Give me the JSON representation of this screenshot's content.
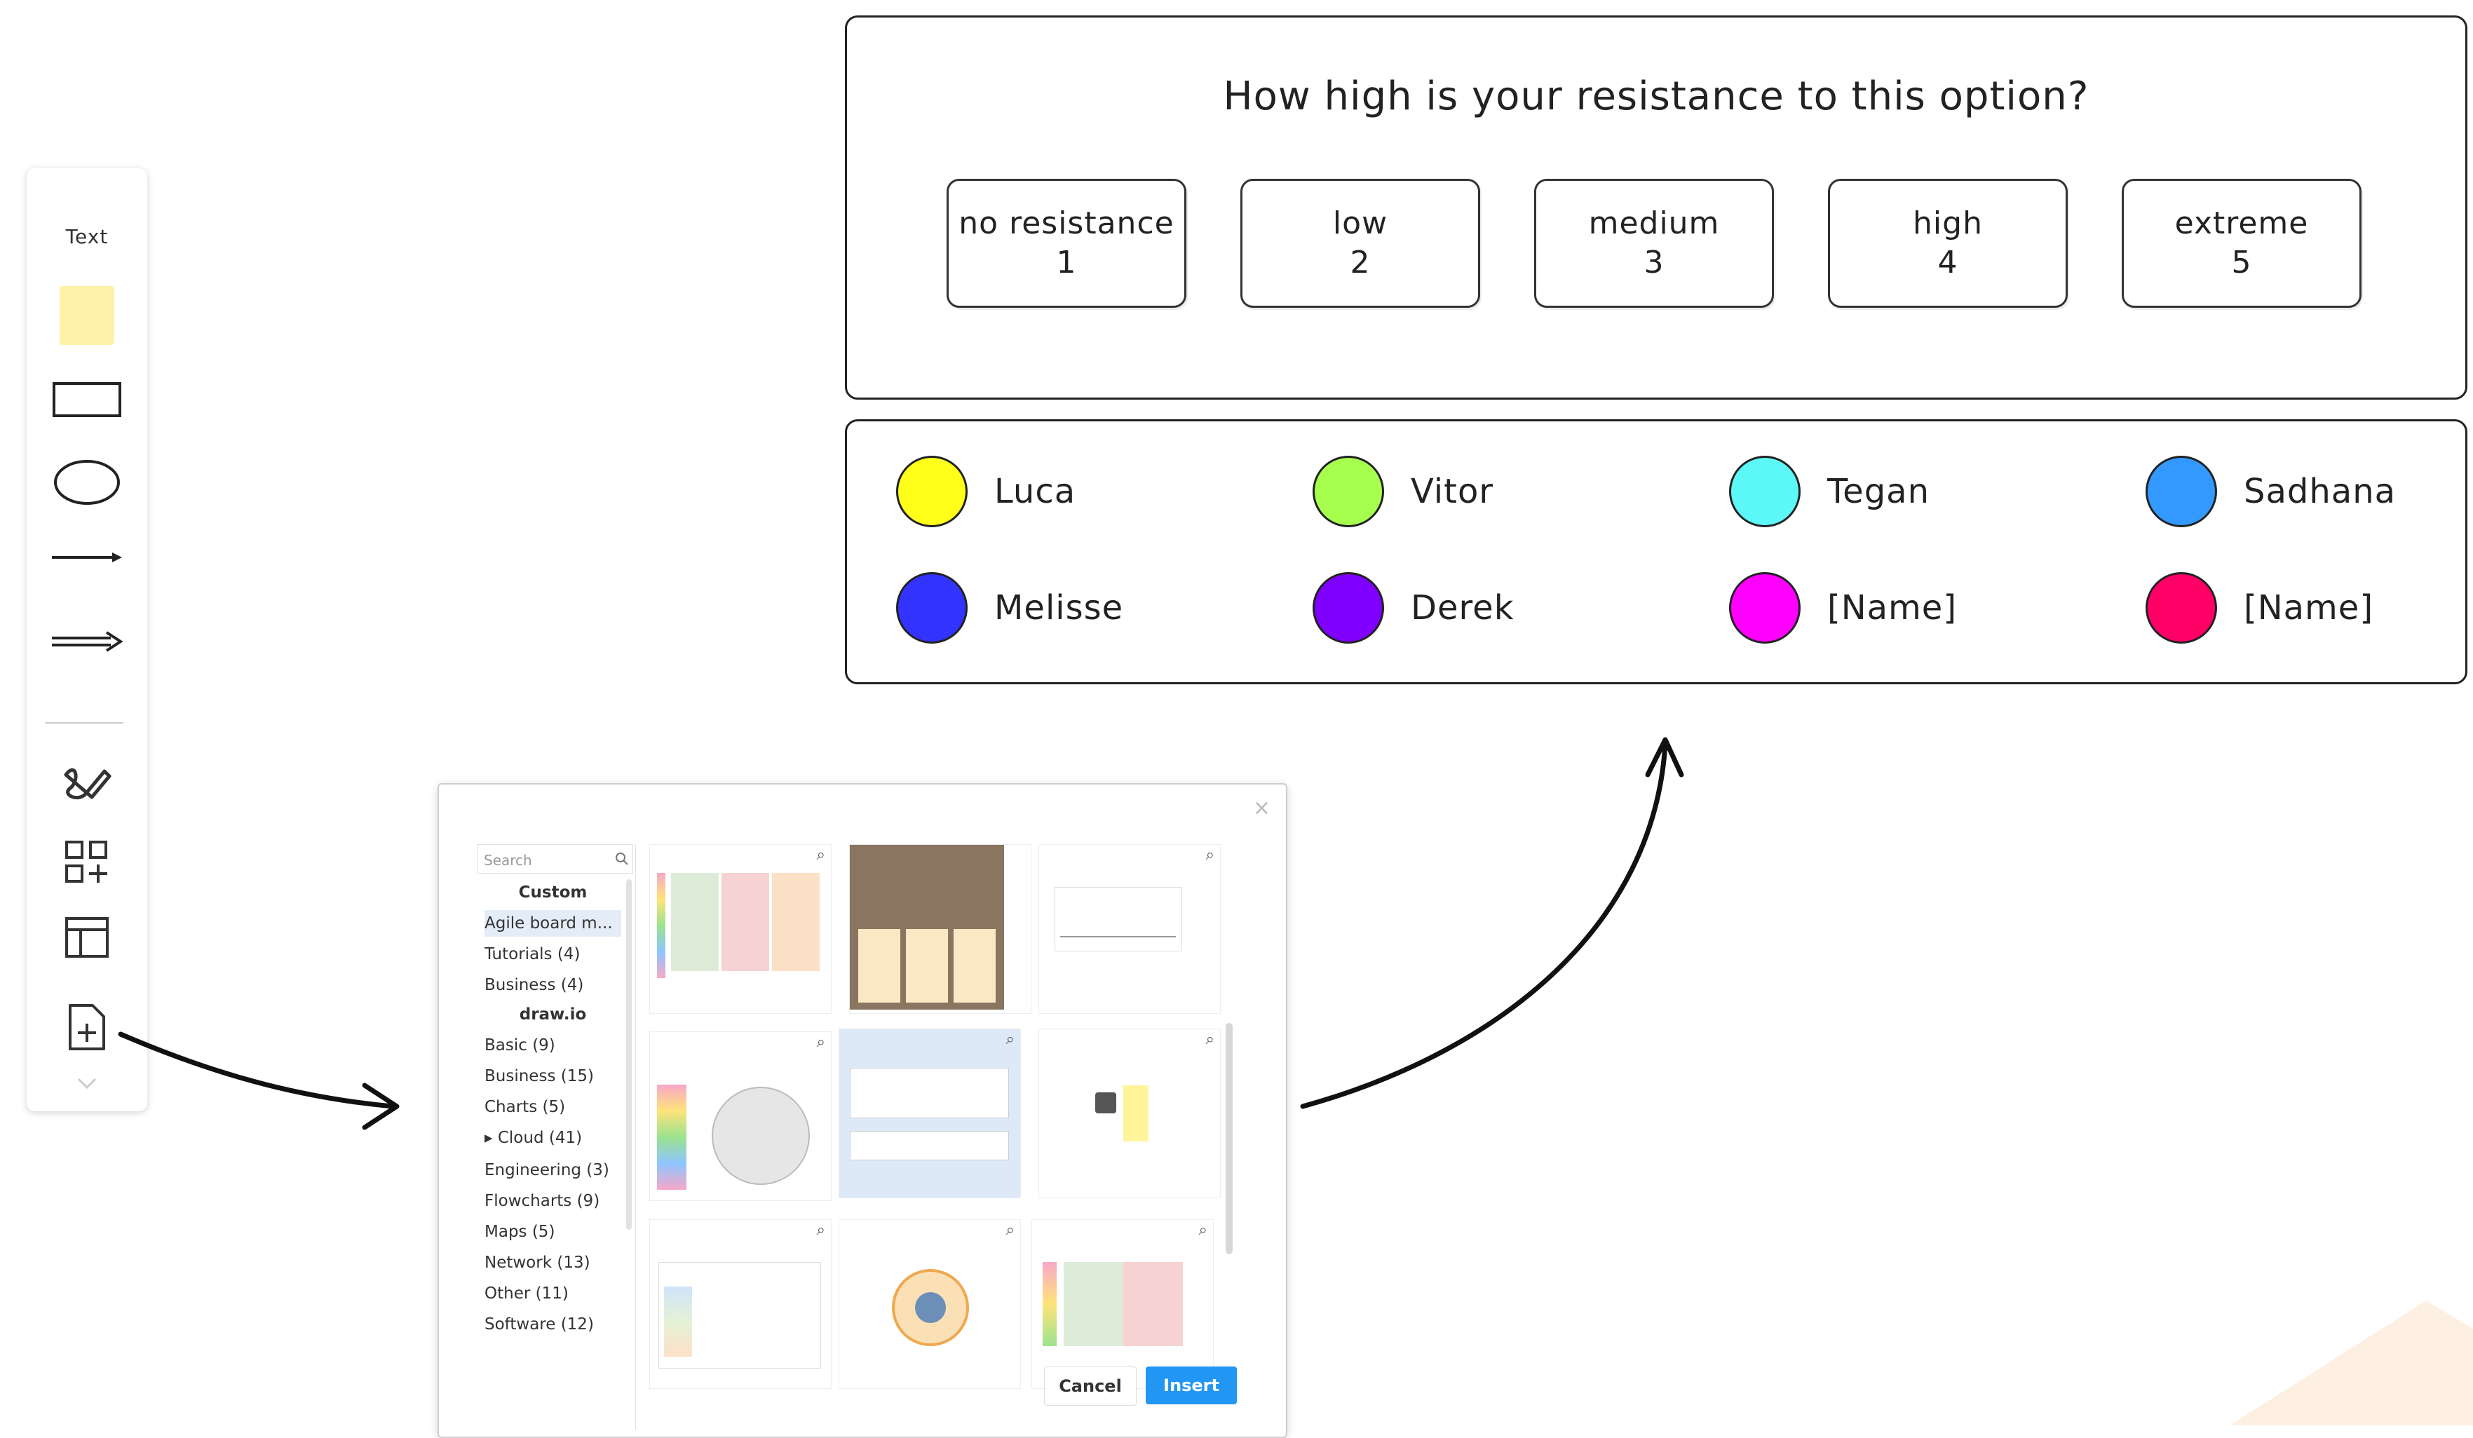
{
  "toolbar": {
    "text_label": "Text",
    "tools": [
      {
        "icon": "text-tool"
      },
      {
        "icon": "sticky-note-icon"
      },
      {
        "icon": "rectangle-icon"
      },
      {
        "icon": "ellipse-icon"
      },
      {
        "icon": "line-arrow-icon"
      },
      {
        "icon": "double-arrow-icon"
      },
      {
        "icon": "freehand-icon"
      },
      {
        "icon": "shapes-add-icon"
      },
      {
        "icon": "table-icon"
      },
      {
        "icon": "template-add-icon"
      },
      {
        "icon": "chevron-down-icon"
      }
    ]
  },
  "scale": {
    "question": "How high is your resistance to this option?",
    "options": [
      {
        "label": "no resistance",
        "value": "1"
      },
      {
        "label": "low",
        "value": "2"
      },
      {
        "label": "medium",
        "value": "3"
      },
      {
        "label": "high",
        "value": "4"
      },
      {
        "label": "extreme",
        "value": "5"
      }
    ]
  },
  "people": [
    {
      "name": "Luca",
      "color": "#ffff1a"
    },
    {
      "name": "Vitor",
      "color": "#a6ff4d"
    },
    {
      "name": "Tegan",
      "color": "#5cf7f7"
    },
    {
      "name": "Sadhana",
      "color": "#3399ff"
    },
    {
      "name": "Melisse",
      "color": "#3333ff"
    },
    {
      "name": "Derek",
      "color": "#7f00ff"
    },
    {
      "name": "[Name]",
      "color": "#ff00ff"
    },
    {
      "name": "[Name]",
      "color": "#ff0066"
    }
  ],
  "dialog": {
    "close": "×",
    "search_placeholder": "Search",
    "categories": [
      {
        "label": "Custom",
        "header": true
      },
      {
        "label": "Agile board m...",
        "selected": true
      },
      {
        "label": "Tutorials (4)"
      },
      {
        "label": "Business (4)"
      },
      {
        "label": "draw.io",
        "header": true
      },
      {
        "label": "Basic (9)"
      },
      {
        "label": "Business (15)"
      },
      {
        "label": "Charts (5)"
      },
      {
        "label": "▸ Cloud (41)"
      },
      {
        "label": "Engineering (3)"
      },
      {
        "label": "Flowcharts (9)"
      },
      {
        "label": "Maps (5)"
      },
      {
        "label": "Network (13)"
      },
      {
        "label": "Other (11)"
      },
      {
        "label": "Software (12)"
      }
    ],
    "cancel_label": "Cancel",
    "insert_label": "Insert",
    "accent": "#2196f3"
  }
}
